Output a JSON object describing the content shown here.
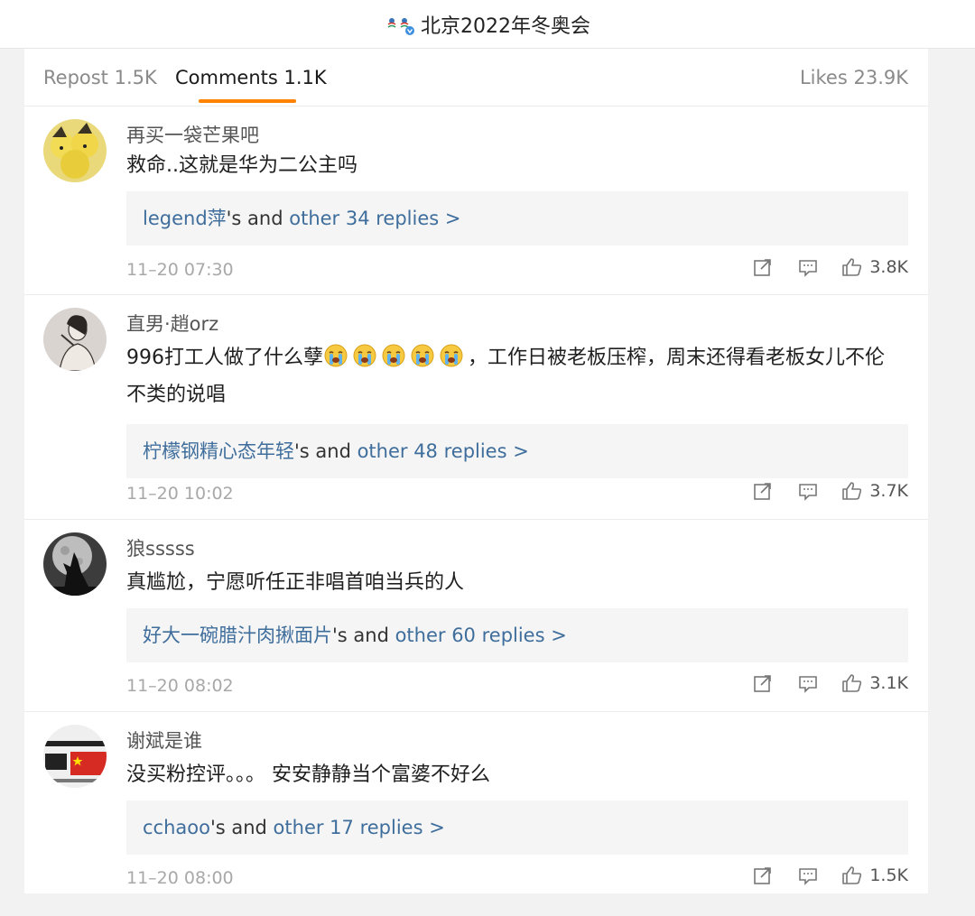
{
  "header": {
    "title": "北京2022年冬奥会"
  },
  "tabs": {
    "repost": "Repost 1.5K",
    "comments": "Comments 1.1K",
    "likes": "Likes 23.9K"
  },
  "colors": {
    "accent": "#ff8200",
    "link": "#3f6e9c"
  },
  "icons": [
    "share-icon",
    "comment-icon",
    "thumbs-up-icon"
  ],
  "comments": [
    {
      "user": "再买一袋芒果吧",
      "text": "救命..这就是华为二公主吗",
      "reply_user": "legend萍",
      "reply_mid": "'s and ",
      "reply_link": "other 34 replies >",
      "time": "11–20 07:30",
      "likes": "3.8K"
    },
    {
      "user": "直男·趙orz",
      "text_a": "996打工人做了什么孽",
      "text_b": "，工作日被老板压榨，周末还得看老板女儿不伦不类的说唱",
      "emoji_name": "crying-emoji",
      "emoji_count": 5,
      "reply_user": "柠檬钢精心态年轻",
      "reply_mid": "'s and ",
      "reply_link": "other 48 replies >",
      "time": "11–20 10:02",
      "likes": "3.7K"
    },
    {
      "user": "狼sssss",
      "text": "真尴尬，宁愿听任正非唱首咱当兵的人",
      "reply_user": "好大一碗腊汁肉揪面片",
      "reply_mid": "'s and ",
      "reply_link": "other 60 replies >",
      "time": "11–20 08:02",
      "likes": "3.1K"
    },
    {
      "user": "谢斌是谁",
      "text": "没买粉控评。。。 安安静静当个富婆不好么",
      "reply_user": "cchaoo",
      "reply_mid": "'s and ",
      "reply_link": "other 17 replies >",
      "time": "11–20 08:00",
      "likes": "1.5K"
    }
  ]
}
